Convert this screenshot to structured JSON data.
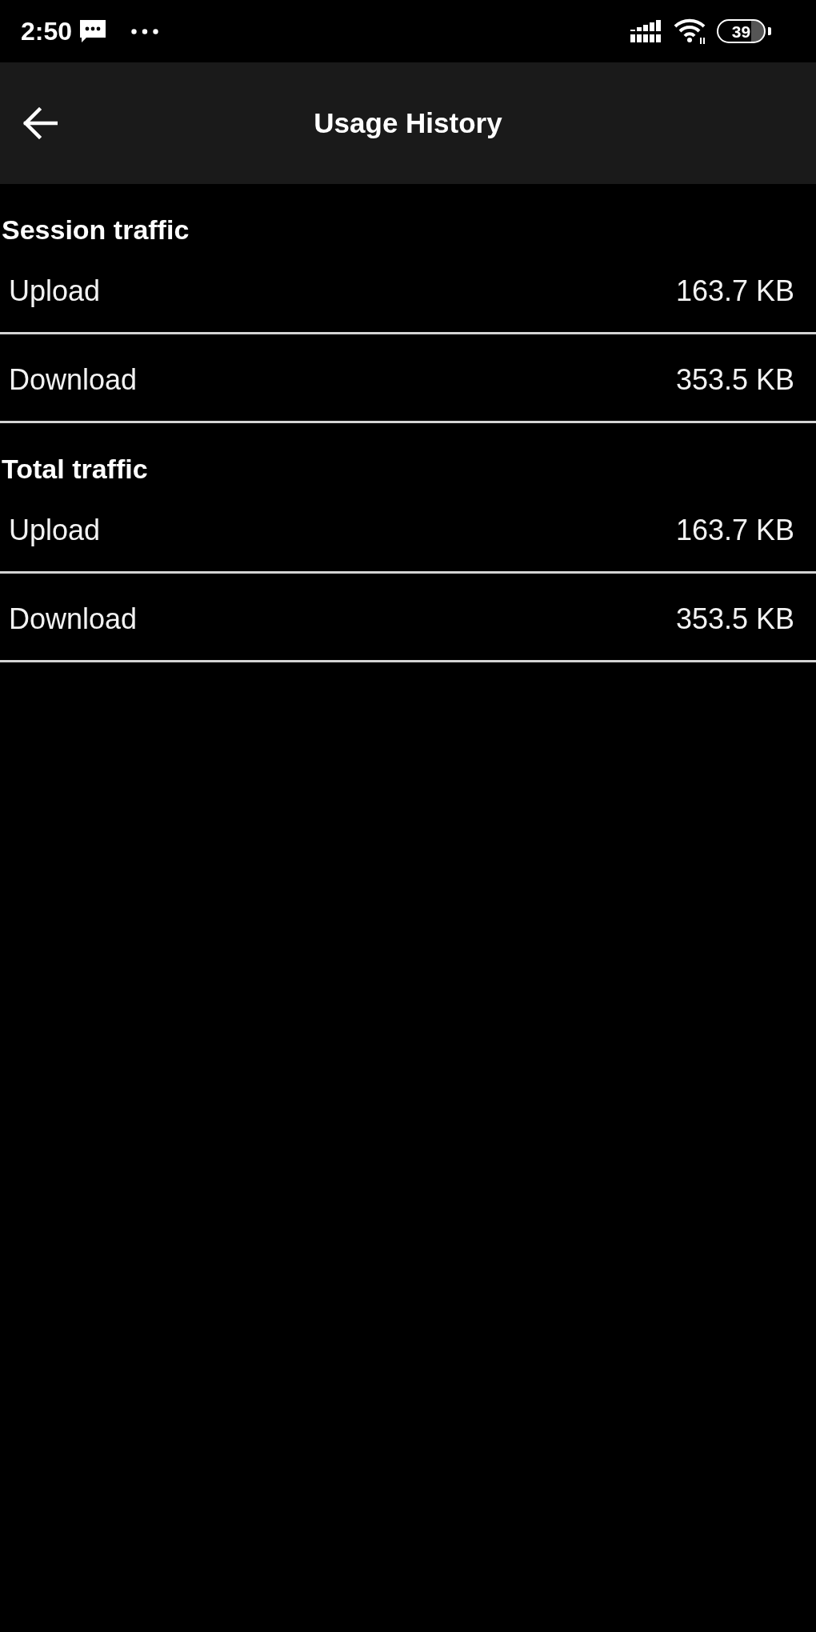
{
  "status_bar": {
    "time": "2:50",
    "battery": "39"
  },
  "app_bar": {
    "title": "Usage History"
  },
  "sections": [
    {
      "title": "Session traffic",
      "rows": [
        {
          "label": "Upload",
          "value": "163.7 KB"
        },
        {
          "label": "Download",
          "value": "353.5 KB"
        }
      ]
    },
    {
      "title": "Total traffic",
      "rows": [
        {
          "label": "Upload",
          "value": "163.7 KB"
        },
        {
          "label": "Download",
          "value": "353.5 KB"
        }
      ]
    }
  ]
}
